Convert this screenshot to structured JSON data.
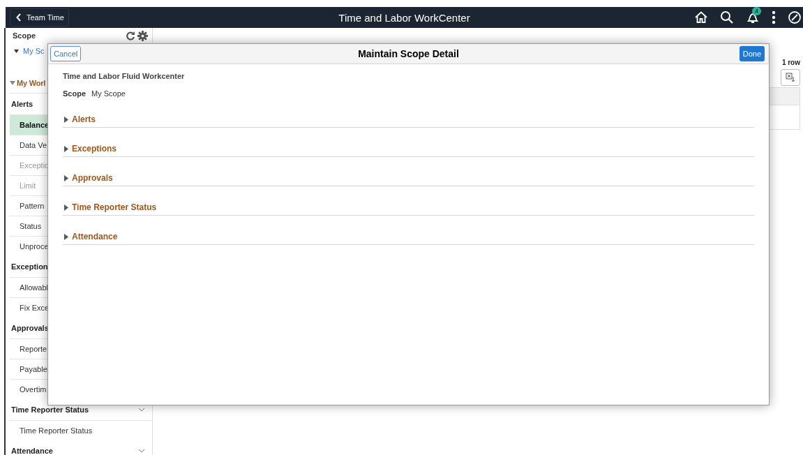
{
  "header": {
    "back_button": "Team Time",
    "title": "Time and Labor WorkCenter",
    "notification_count": "4"
  },
  "sidebar": {
    "scope_label": "Scope",
    "scope_item": "My Sc",
    "section": "My Worl",
    "groups": [
      {
        "label": "Alerts",
        "items": [
          {
            "label": "Balance",
            "selected": true,
            "disabled": false
          },
          {
            "label": "Data Ve",
            "selected": false,
            "disabled": false
          },
          {
            "label": "Exceptic",
            "selected": false,
            "disabled": true
          },
          {
            "label": "Limit",
            "selected": false,
            "disabled": true
          },
          {
            "label": "Pattern",
            "selected": false,
            "disabled": false
          },
          {
            "label": "Status",
            "selected": false,
            "disabled": false
          },
          {
            "label": "Unproce",
            "selected": false,
            "disabled": false
          }
        ]
      },
      {
        "label": "Exception",
        "items": [
          {
            "label": "Allowabl",
            "selected": false,
            "disabled": false
          },
          {
            "label": "Fix Exce",
            "selected": false,
            "disabled": false
          }
        ]
      },
      {
        "label": "Approvals",
        "items": [
          {
            "label": "Reporte",
            "selected": false,
            "disabled": false
          },
          {
            "label": "Payable",
            "selected": false,
            "disabled": false
          },
          {
            "label": "Overtim",
            "selected": false,
            "disabled": false
          }
        ]
      },
      {
        "label": "Time Reporter Status",
        "chevron": true,
        "items": [
          {
            "label": "Time Reporter Status",
            "selected": false,
            "disabled": false
          }
        ]
      },
      {
        "label": "Attendance",
        "chevron": true
      }
    ]
  },
  "content": {
    "row_count": "1 row"
  },
  "modal": {
    "cancel": "Cancel",
    "title": "Maintain Scope Detail",
    "done": "Done",
    "subtitle": "Time and Labor Fluid Workcenter",
    "scope_label": "Scope",
    "scope_value": "My Scope",
    "sections": [
      {
        "label": "Alerts",
        "expanded": false
      },
      {
        "label": "Exceptions",
        "expanded": false
      },
      {
        "label": "Approvals",
        "expanded": false
      },
      {
        "label": "Time Reporter Status",
        "expanded": false
      },
      {
        "label": "Attendance",
        "expanded": false
      }
    ]
  }
}
